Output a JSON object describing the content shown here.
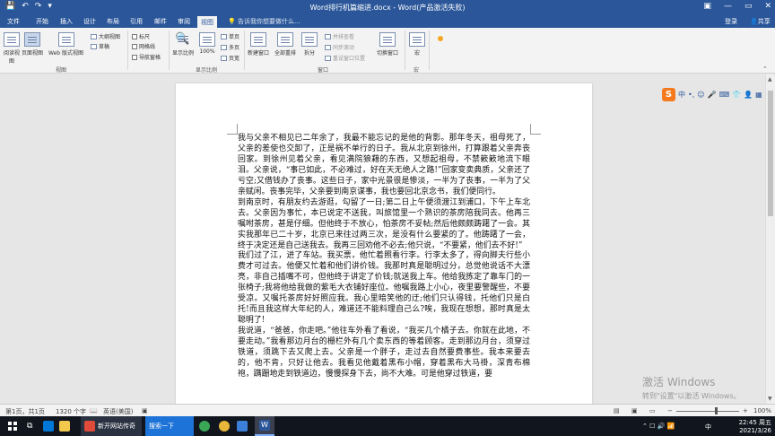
{
  "window": {
    "title": "Word排行机篇缩进.docx - Word(产品激活失败)",
    "minimize": "—",
    "restore": "▭",
    "close": "✕"
  },
  "qat": {
    "save_icon": "save-icon",
    "undo_icon": "undo-icon",
    "redo_icon": "redo-icon"
  },
  "tabs": [
    "文件",
    "开始",
    "插入",
    "设计",
    "布局",
    "引用",
    "邮件",
    "审阅",
    "视图"
  ],
  "active_tab": "视图",
  "tellme": "告诉我你想要做什么...",
  "account": {
    "signin": "登录",
    "share": "共享"
  },
  "ribbon": {
    "views": {
      "read_mode": "阅读视图",
      "print_layout": "页面视图",
      "web_layout": "Web 版式视图",
      "outline": "大纲视图",
      "draft": "草稿",
      "group_label": "视图"
    },
    "show": {
      "ruler": "标尺",
      "gridlines": "网格线",
      "nav_pane": "导航窗格"
    },
    "zoom": {
      "zoom_btn": "显示比例",
      "hundred": "100%",
      "one_page": "单页",
      "multi_page": "多页",
      "page_width": "页宽",
      "group_label": "显示比例"
    },
    "window": {
      "new_window": "新建窗口",
      "arrange_all": "全部重排",
      "split": "拆分",
      "side_by_side": "并排查看",
      "sync_scroll": "同步滚动",
      "reset_position": "重设窗口位置",
      "switch": "切换窗口",
      "group_label": "窗口"
    },
    "macros": {
      "macros": "宏",
      "group_label": "宏"
    }
  },
  "ime": {
    "mode": "中",
    "punct": "•,",
    "items": [
      "☺",
      "🎤",
      "⌨",
      "👕",
      "👤",
      "▦"
    ]
  },
  "document": {
    "paragraphs": [
      "我与父亲不相见已二年余了，我最不能忘记的是他的背影。那年冬天，祖母死了，父亲的差使也交卸了，正是祸不单行的日子。我从北京到徐州，打算跟着父亲奔丧回家。到徐州见着父亲，看见满院狼藉的东西，又想起祖母，不禁簌簌地流下眼泪。父亲说，“事已如此，不必难过，好在天无绝人之路!”回家变卖典质，父亲还了亏空;又借钱办了丧事。这些日子，家中光景很是惨淡，一半为了丧事，一半为了父亲赋闲。丧事完毕，父亲要到南京谋事，我也要回北京念书，我们便同行。",
      "到南京时，有朋友约去游逛，勾留了一日;第二日上午便须渡江到浦口，下午上车北去。父亲因为事忙，本已说定不送我，叫旅馆里一个熟识的茶房陪我同去。他再三嘱咐茶房，甚是仔细。但他终于不放心，怕茶房不妥帖;然后他颇颇踌躇了一会。其实我那年已二十岁，北京已来往过两三次，是没有什么要紧的了。他踌躇了一会，终于决定还是自己送我去。我再三回劝他不必去;他只说，“不要紧，他们去不好!”",
      "我们过了江，进了车站。我买票，他忙着照看行李。行李太多了，得向脚夫行些小费才可过去。他便又忙着和他们讲价钱。我那时真是聪明过分，总觉他说话不大漂亮，非自己插嘴不可，但他终于讲定了价钱;就送我上车。他给我拣定了靠车门的一张椅子;我将他给我做的紫毛大衣铺好座位。他嘱我路上小心，夜里要警醒些，不要受凉。又嘱托茶房好好照应我。我心里暗笑他的迂;他们只认得钱，托他们只是白托!而且我这样大年纪的人，难道还不能料理自己么?唉，我现在想想，那时真是太聪明了!",
      "我说道，“爸爸，你走吧。”他往车外看了看说，“我买几个橘子去。你就在此地，不要走动。”我看那边月台的栅栏外有几个卖东西的等着顾客。走到那边月台，须穿过铁道，须跳下去又爬上去。父亲是一个胖子，走过去自然要费事些。我本来要去的，他不肯，只好让他去。我看见他戴着黑布小帽，穿着黑布大马褂，深青布棉袍，蹒跚地走到铁道边，慢慢探身下去，尚不大难。可是他穿过铁道，要"
    ]
  },
  "status": {
    "page": "第1页，共1页",
    "words": "1320 个字",
    "lang": "英语(美国)",
    "zoom_pct": "100%"
  },
  "activation": {
    "line1": "激活 Windows",
    "line2": "转到\"设置\"以激活 Windows。"
  },
  "taskbar": {
    "app1": "新开网站传奇",
    "search_label": "搜索一下",
    "tray_ime": "中",
    "time": "22:45 周五",
    "date": "2021/3/26"
  }
}
